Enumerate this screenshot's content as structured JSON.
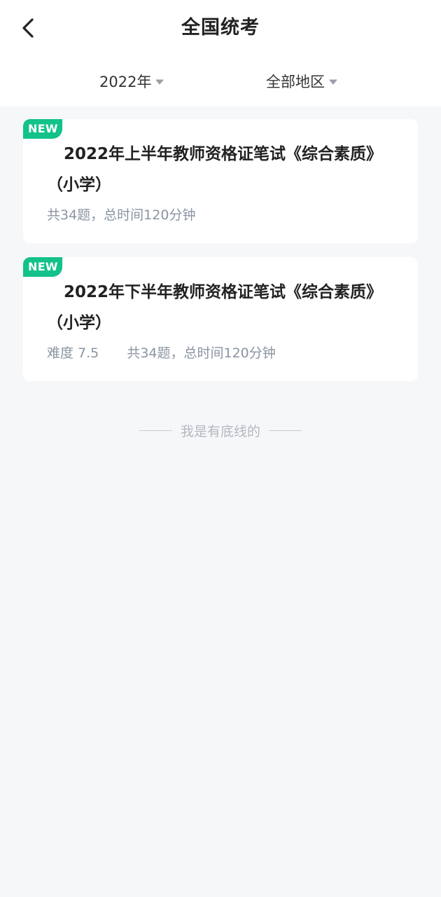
{
  "header": {
    "title": "全国统考",
    "back_icon": "chevron-left-icon"
  },
  "filters": {
    "year": "2022年",
    "region": "全部地区",
    "caret_icon": "caret-down-icon"
  },
  "papers": [
    {
      "badge": "NEW",
      "title": "2022年上半年教师资格证笔试《综合素质》（小学）",
      "meta": "共34题，总时间120分钟"
    },
    {
      "badge": "NEW",
      "title": "2022年下半年教师资格证笔试《综合素质》（小学）",
      "difficulty": "难度 7.5",
      "meta": "共34题，总时间120分钟"
    }
  ],
  "footer": {
    "text": "我是有底线的"
  },
  "colors": {
    "accent": "#12c28a",
    "background": "#f6f7f9",
    "meta_text": "#8a94a3"
  }
}
